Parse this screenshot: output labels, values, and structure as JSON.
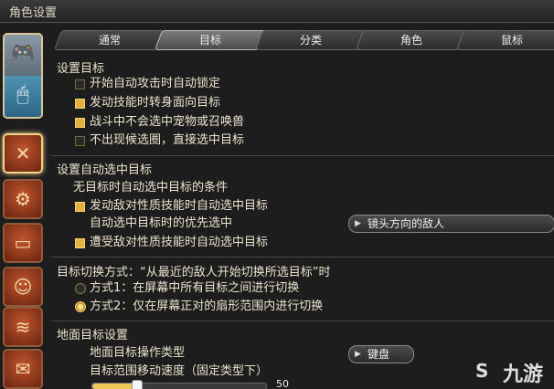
{
  "window": {
    "title": "角色设置"
  },
  "tabs": [
    {
      "label": "通常"
    },
    {
      "label": "目标"
    },
    {
      "label": "分类"
    },
    {
      "label": "角色"
    },
    {
      "label": "鼠标"
    }
  ],
  "rail": {
    "top_glyph": "🎮",
    "bottom_glyph": "🖱",
    "icons": [
      {
        "name": "crossed-swords-icon",
        "glyph": "✕"
      },
      {
        "name": "crafting-icon",
        "glyph": "⚙"
      },
      {
        "name": "card-icon",
        "glyph": "▭"
      },
      {
        "name": "character-icon",
        "glyph": "☺"
      },
      {
        "name": "map-icon",
        "glyph": "≋"
      },
      {
        "name": "chat-icon",
        "glyph": "✉"
      }
    ]
  },
  "sections": {
    "set_target": {
      "title": "设置目标",
      "options": [
        {
          "label": "开始自动攻击时自动锁定",
          "checked": false
        },
        {
          "label": "发动技能时转身面向目标",
          "checked": true
        },
        {
          "label": "战斗中不会选中宠物或召唤兽",
          "checked": true
        },
        {
          "label": "不出现候选圈，直接选中目标",
          "checked": false
        }
      ]
    },
    "auto_select": {
      "title": "设置自动选中目标",
      "subtitle": "无目标时自动选中目标的条件",
      "opt1": "发动敌对性质技能时自动选中目标",
      "priority_label": "自动选中目标时的优先选中",
      "priority_value": "镜头方向的敌人",
      "opt2": "遭受敌对性质技能时自动选中目标"
    },
    "switch": {
      "title": "目标切换方式：“从最近的敌人开始切换所选目标”时",
      "mode1": "方式1：在屏幕中所有目标之间进行切换",
      "mode2": "方式2：仅在屏幕正对的扇形范围内进行切换",
      "selected": 2
    },
    "ground": {
      "title": "地面目标设置",
      "op_type_label": "地面目标操作类型",
      "op_type_value": "键盘",
      "speed_label": "目标范围移动速度（固定类型下）",
      "speed_value": "50",
      "speed_fraction": 0.25
    }
  },
  "watermark": {
    "text": "九游",
    "icon": "S"
  },
  "colors": {
    "accent": "#e3b23a",
    "bg": "#1d1d1d",
    "text": "#ece3cf"
  }
}
